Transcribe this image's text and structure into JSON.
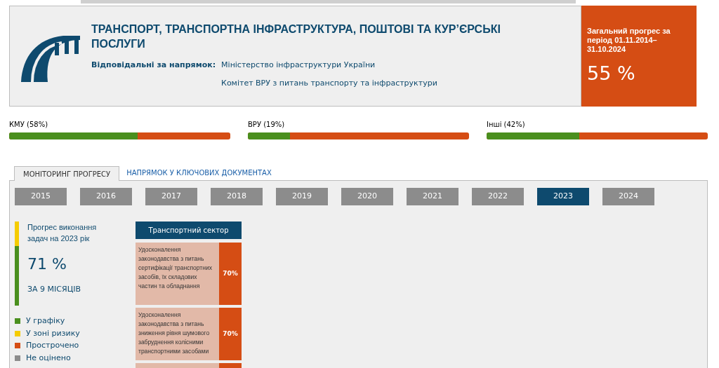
{
  "header": {
    "title": "ТРАНСПОРТ, ТРАНСПОРТНА ІНФРАСТРУКТУРА, ПОШТОВІ ТА КУР’ЄРСЬКІ ПОСЛУГИ",
    "responsible_label": "Відповідальні за напрямок:",
    "responsible": [
      "Міністерство інфраструктури України",
      "Комітет ВРУ з питань транспорту та інфраструктури"
    ]
  },
  "overall": {
    "label": "Загальний прогрес за період 01.11.2014–31.10.2024",
    "value": "55 %"
  },
  "bars": [
    {
      "label": "КМУ (58%)",
      "level": 0.58
    },
    {
      "label": "ВРУ (19%)",
      "level": 0.19
    },
    {
      "label": "Інші (42%)",
      "level": 0.42
    }
  ],
  "tabs": [
    {
      "label": "МОНІТОРИНГ ПРОГРЕСУ",
      "selected": true
    },
    {
      "label": "НАПРЯМОК У КЛЮЧОВИХ ДОКУМЕНТАХ",
      "selected": false
    }
  ],
  "years": [
    {
      "label": "2015",
      "selected": false
    },
    {
      "label": "2016",
      "selected": false
    },
    {
      "label": "2017",
      "selected": false
    },
    {
      "label": "2018",
      "selected": false
    },
    {
      "label": "2019",
      "selected": false
    },
    {
      "label": "2020",
      "selected": false
    },
    {
      "label": "2021",
      "selected": false
    },
    {
      "label": "2022",
      "selected": false
    },
    {
      "label": "2023",
      "selected": true
    },
    {
      "label": "2024",
      "selected": false
    }
  ],
  "progress": {
    "title": "Прогрес виконання задач на 2023 рік",
    "value": "71 %",
    "period": "ЗА 9 МІСЯЦІВ",
    "level": 0.71
  },
  "legend": [
    {
      "label": "У графіку",
      "color": "#4a8f1e"
    },
    {
      "label": "У зоні ризику",
      "color": "#f5cc00"
    },
    {
      "label": "Прострочено",
      "color": "#d54d14"
    },
    {
      "label": "Не оцінено",
      "color": "#8c8c8c"
    }
  ],
  "sector": {
    "title": "Транспортний сектор",
    "tasks": [
      {
        "kind": "task",
        "text": "Удосконалення законодавства з питань сертифікації транспортних засобів, їх складових частин та обладнання",
        "value": "70%"
      },
      {
        "kind": "task",
        "text": "Удосконалення законодавства з питань зниження рівня шумового забруднення колісними транспортними засобами",
        "value": "70%"
      },
      {
        "kind": "cut"
      }
    ]
  }
}
